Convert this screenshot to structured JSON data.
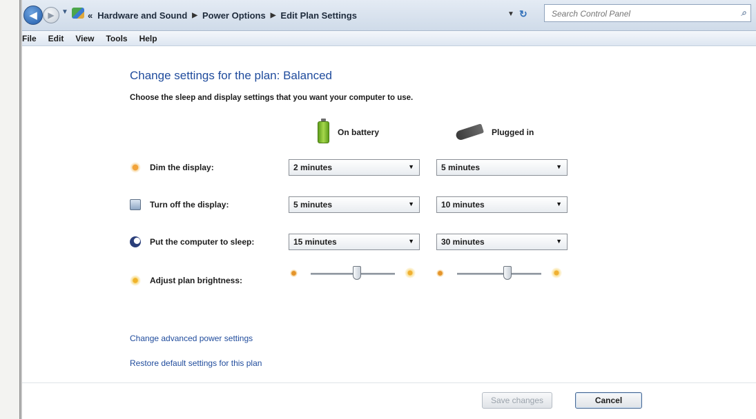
{
  "address_bar": {
    "breadcrumbs": [
      "Hardware and Sound",
      "Power Options",
      "Edit Plan Settings"
    ],
    "overflow_marker": "«",
    "search_placeholder": "Search Control Panel"
  },
  "menu": [
    "File",
    "Edit",
    "View",
    "Tools",
    "Help"
  ],
  "main": {
    "title": "Change settings for the plan: Balanced",
    "subtitle": "Choose the sleep and display settings that you want your computer to use.",
    "columns": {
      "on_battery": "On battery",
      "plugged_in": "Plugged in"
    },
    "rows": [
      {
        "label": "Dim the display:",
        "icon": "dim-icon",
        "on_battery": "2 minutes",
        "plugged_in": "5 minutes"
      },
      {
        "label": "Turn off the display:",
        "icon": "monitor-icon",
        "on_battery": "5 minutes",
        "plugged_in": "10 minutes"
      },
      {
        "label": "Put the computer to sleep:",
        "icon": "moon-icon",
        "on_battery": "15 minutes",
        "plugged_in": "30 minutes"
      }
    ],
    "brightness": {
      "label": "Adjust plan brightness:",
      "on_battery_level": 0.55,
      "plugged_in_level": 0.6
    },
    "links": {
      "advanced": "Change advanced power settings",
      "restore": "Restore default settings for this plan"
    },
    "buttons": {
      "save": "Save changes",
      "cancel": "Cancel"
    }
  },
  "colors": {
    "link": "#1f4b9c",
    "heading": "#1f4b9c"
  }
}
